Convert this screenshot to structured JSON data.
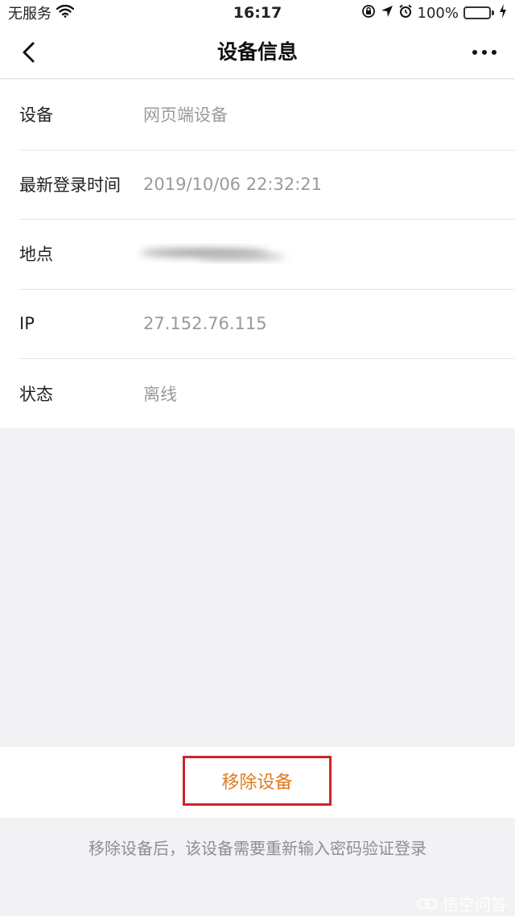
{
  "status_bar": {
    "carrier": "无服务",
    "time": "16:17",
    "battery": "100%",
    "icons": [
      "wifi-icon",
      "rotation-lock-icon",
      "location-icon",
      "alarm-icon",
      "battery-icon",
      "charging-icon"
    ]
  },
  "nav": {
    "title": "设备信息",
    "back_icon": "chevron-left-icon",
    "more_icon": "more-icon"
  },
  "info": {
    "rows": [
      {
        "label": "设备",
        "value": "网页端设备"
      },
      {
        "label": "最新登录时间",
        "value": "2019/10/06 22:32:21"
      },
      {
        "label": "地点",
        "value": ""
      },
      {
        "label": "IP",
        "value": "27.152.76.115"
      },
      {
        "label": "状态",
        "value": "离线"
      }
    ]
  },
  "actions": {
    "remove_label": "移除设备",
    "note": "移除设备后，该设备需要重新输入密码验证登录"
  },
  "watermark": {
    "text": "悟空问答"
  },
  "colors": {
    "accent": "#e07a1f",
    "highlight_border": "#d0232a",
    "battery_green": "#4cd964",
    "background": "#f2f2f4"
  }
}
